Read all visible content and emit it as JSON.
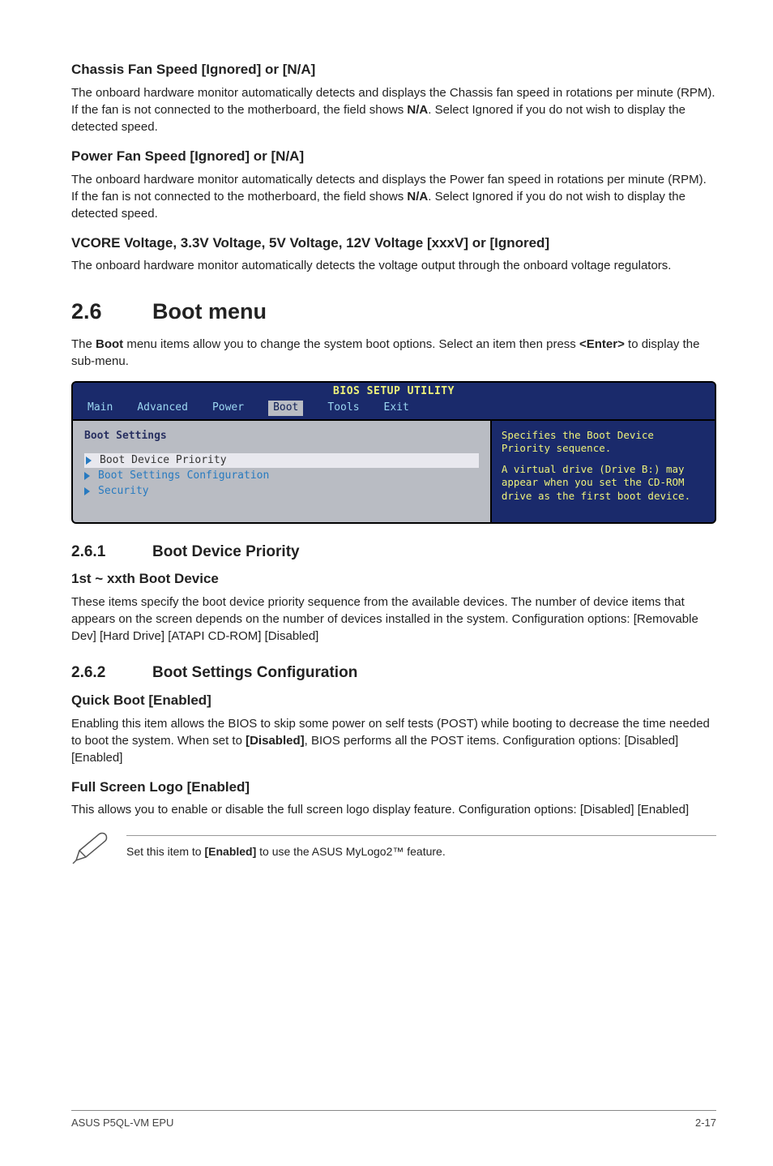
{
  "s1": {
    "h": "Chassis Fan Speed [Ignored] or [N/A]",
    "p_pre": "The onboard hardware monitor automatically detects and displays the Chassis fan speed in rotations per minute (RPM). If the fan is not connected to the motherboard, the field shows ",
    "b": "N/A",
    "p_post": ". Select Ignored if you do not wish to display the detected speed."
  },
  "s2": {
    "h": "Power Fan Speed [Ignored] or [N/A]",
    "p_pre": "The onboard hardware monitor automatically detects and displays the Power fan speed in rotations per minute (RPM). If the fan is not connected to the motherboard, the field shows ",
    "b": "N/A",
    "p_post": ". Select Ignored if you do not wish to display the detected speed."
  },
  "s3": {
    "h": "VCORE Voltage, 3.3V Voltage, 5V Voltage, 12V Voltage [xxxV] or [Ignored]",
    "p": "The onboard hardware monitor automatically detects the voltage output through the onboard voltage regulators."
  },
  "sec26": {
    "num": "2.6",
    "name": "Boot menu",
    "pre": "The ",
    "b": "Boot",
    "mid": " menu items allow you to change the system boot options. Select an item then press ",
    "b2": "<Enter>",
    "post": " to display the sub-menu."
  },
  "bios": {
    "title": "BIOS SETUP UTILITY",
    "tabs": {
      "t0": "Main",
      "t1": "Advanced",
      "t2": "Power",
      "t3": "Boot",
      "t4": "Tools",
      "t5": "Exit"
    },
    "left": {
      "heading": "Boot Settings",
      "m0": "Boot Device Priority",
      "m1": "Boot Settings Configuration",
      "m2": "Security"
    },
    "right": {
      "p0": "Specifies the Boot Device Priority sequence.",
      "p1": "A virtual drive (Drive B:) may appear when you set the CD-ROM drive as the first boot device."
    }
  },
  "sub261": {
    "num": "2.6.1",
    "name": "Boot Device Priority",
    "h": "1st ~ xxth Boot Device",
    "p": "These items specify the boot device priority sequence from the available devices. The number of device items that appears on the screen depends on the number of devices installed in the system. Configuration options: [Removable Dev] [Hard Drive] [ATAPI CD-ROM] [Disabled]"
  },
  "sub262": {
    "num": "2.6.2",
    "name": "Boot Settings Configuration",
    "h1": "Quick Boot [Enabled]",
    "p1_pre": "Enabling this item allows the BIOS to skip some power on self tests (POST) while booting to decrease the time needed to boot the system. When set to ",
    "p1_b": "[Disabled]",
    "p1_post": ", BIOS performs all the POST items. Configuration options: [Disabled] [Enabled]",
    "h2": "Full Screen Logo [Enabled]",
    "p2": "This allows you to enable or disable the full screen logo display feature. Configuration options: [Disabled] [Enabled]"
  },
  "note": {
    "pre": "Set this item to ",
    "b": "[Enabled]",
    "post": " to use the ASUS MyLogo2™ feature."
  },
  "footer": {
    "left": "ASUS P5QL-VM EPU",
    "right": "2-17"
  }
}
